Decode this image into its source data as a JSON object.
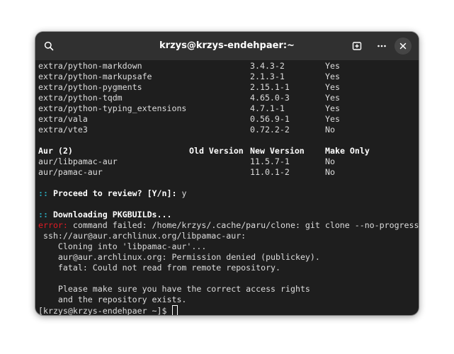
{
  "window": {
    "title": "krzys@krzys-endehpaer:~",
    "icons": {
      "search": "search-icon",
      "new_tab": "new-tab-icon",
      "menu": "more-icon",
      "close": "close-icon"
    }
  },
  "packages": [
    {
      "name": "extra/python-markdown",
      "new_version": "3.4.3-2",
      "make_only": "Yes"
    },
    {
      "name": "extra/python-markupsafe",
      "new_version": "2.1.3-1",
      "make_only": "Yes"
    },
    {
      "name": "extra/python-pygments",
      "new_version": "2.15.1-1",
      "make_only": "Yes"
    },
    {
      "name": "extra/python-tqdm",
      "new_version": "4.65.0-3",
      "make_only": "Yes"
    },
    {
      "name": "extra/python-typing_extensions",
      "new_version": "4.7.1-1",
      "make_only": "Yes"
    },
    {
      "name": "extra/vala",
      "new_version": "0.56.9-1",
      "make_only": "Yes"
    },
    {
      "name": "extra/vte3",
      "new_version": "0.72.2-2",
      "make_only": "No"
    }
  ],
  "aur": {
    "header": {
      "repo": "Aur (2)",
      "old_version": "Old Version",
      "new_version": "New Version",
      "make_only": "Make Only"
    },
    "rows": [
      {
        "name": "aur/libpamac-aur",
        "new_version": "11.5.7-1",
        "make_only": "No"
      },
      {
        "name": "aur/pamac-aur",
        "new_version": "11.0.1-2",
        "make_only": "No"
      }
    ]
  },
  "review": {
    "marker": "::",
    "question": "Proceed to review? [Y/n]:",
    "answer": "y"
  },
  "download": {
    "marker": "::",
    "text": "Downloading PKGBUILDs..."
  },
  "error": {
    "label": "error:",
    "message": "command failed: /home/krzys/.cache/paru/clone: git clone --no-progress --",
    "message_cont": " ssh://aur@aur.archlinux.org/libpamac-aur:",
    "details": [
      "    Cloning into 'libpamac-aur'...",
      "    aur@aur.archlinux.org: Permission denied (publickey).",
      "    fatal: Could not read from remote repository.",
      "",
      "    Please make sure you have the correct access rights",
      "    and the repository exists."
    ]
  },
  "prompt": "[krzys@krzys-endehpaer ~]$"
}
